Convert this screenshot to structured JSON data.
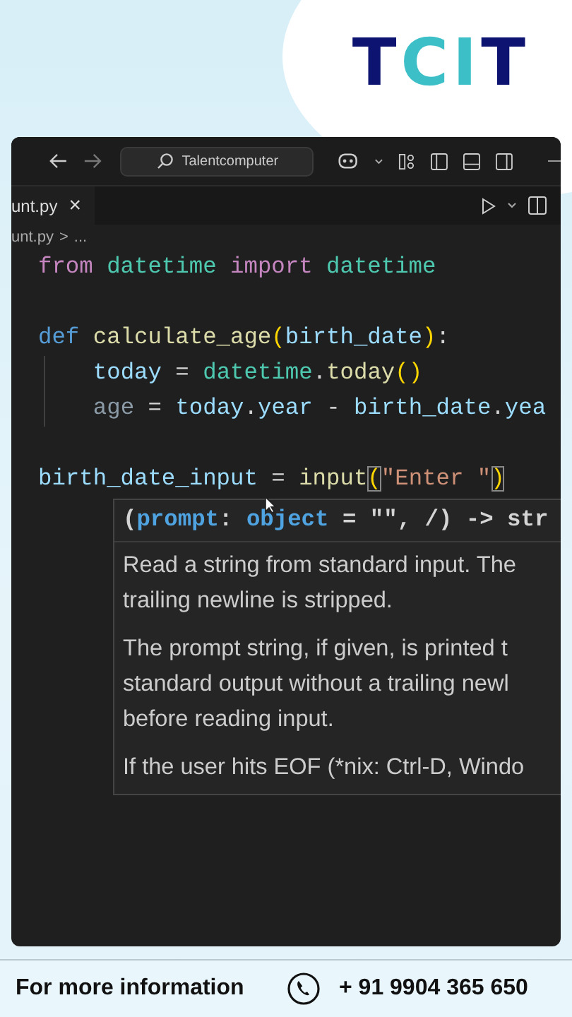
{
  "logo": {
    "letters": [
      {
        "text": "T",
        "color": "#0d1370"
      },
      {
        "text": "C",
        "color": "#3dbfc8"
      },
      {
        "text": "I",
        "color": "#3dbfc8"
      },
      {
        "text": "T",
        "color": "#0d1370"
      }
    ]
  },
  "title_bar": {
    "search": "Talentcomputer"
  },
  "tab": {
    "label": "unt.py",
    "close": "×"
  },
  "breadcrumb": [
    "unt.py",
    ">",
    "..."
  ],
  "code_blocks": [
    [
      {
        "indent": false,
        "tokens": [
          {
            "kind": "keyword",
            "text": "from "
          },
          {
            "kind": "class",
            "text": "datetime "
          },
          {
            "kind": "keyword",
            "text": "import "
          },
          {
            "kind": "class",
            "text": "datetime"
          }
        ]
      }
    ],
    [
      {
        "indent": false,
        "tokens": [
          {
            "kind": "def",
            "text": "def "
          },
          {
            "kind": "func",
            "text": "calculate_age"
          },
          {
            "kind": "bracket",
            "text": "("
          },
          {
            "kind": "param",
            "text": "birth_date"
          },
          {
            "kind": "bracket",
            "text": ")"
          },
          {
            "kind": "plain",
            "text": ":"
          }
        ]
      },
      {
        "indent": true,
        "tokens": [
          {
            "kind": "var",
            "text": "today"
          },
          {
            "kind": "plain",
            "text": " = "
          },
          {
            "kind": "class",
            "text": "datetime"
          },
          {
            "kind": "plain",
            "text": "."
          },
          {
            "kind": "func",
            "text": "today"
          },
          {
            "kind": "bracket",
            "text": "()"
          }
        ]
      },
      {
        "indent": true,
        "tokens": [
          {
            "kind": "dim",
            "text": "age"
          },
          {
            "kind": "plain",
            "text": " = "
          },
          {
            "kind": "var",
            "text": "today"
          },
          {
            "kind": "plain",
            "text": "."
          },
          {
            "kind": "var",
            "text": "year"
          },
          {
            "kind": "plain",
            "text": " - "
          },
          {
            "kind": "var",
            "text": "birth_date"
          },
          {
            "kind": "plain",
            "text": "."
          },
          {
            "kind": "var",
            "text": "yea"
          }
        ]
      }
    ],
    [
      {
        "indent": false,
        "tokens": [
          {
            "kind": "var",
            "text": "birth_date_input"
          },
          {
            "kind": "plain",
            "text": " = "
          },
          {
            "kind": "func",
            "text": "input"
          },
          {
            "kind": "match",
            "text": "("
          },
          {
            "kind": "string",
            "text": "\"Enter \""
          },
          {
            "kind": "match",
            "text": ")"
          }
        ]
      }
    ]
  ],
  "hover": {
    "signature": [
      {
        "kind": "plain",
        "text": "("
      },
      {
        "kind": "param",
        "text": "prompt"
      },
      {
        "kind": "plain",
        "text": ": "
      },
      {
        "kind": "param",
        "text": "object"
      },
      {
        "kind": "plain",
        "text": " = \"\", /) -> str"
      }
    ],
    "paragraphs": [
      [
        "Read a string from standard input. The",
        "trailing newline is stripped."
      ],
      [
        "The prompt string, if given, is printed t",
        "standard output without a trailing newl",
        "before reading input."
      ],
      [
        "If the user hits EOF (*nix: Ctrl-D, Windo"
      ]
    ]
  },
  "footer": {
    "label": "For more information",
    "phone": "+ 91 9904 365 650"
  }
}
